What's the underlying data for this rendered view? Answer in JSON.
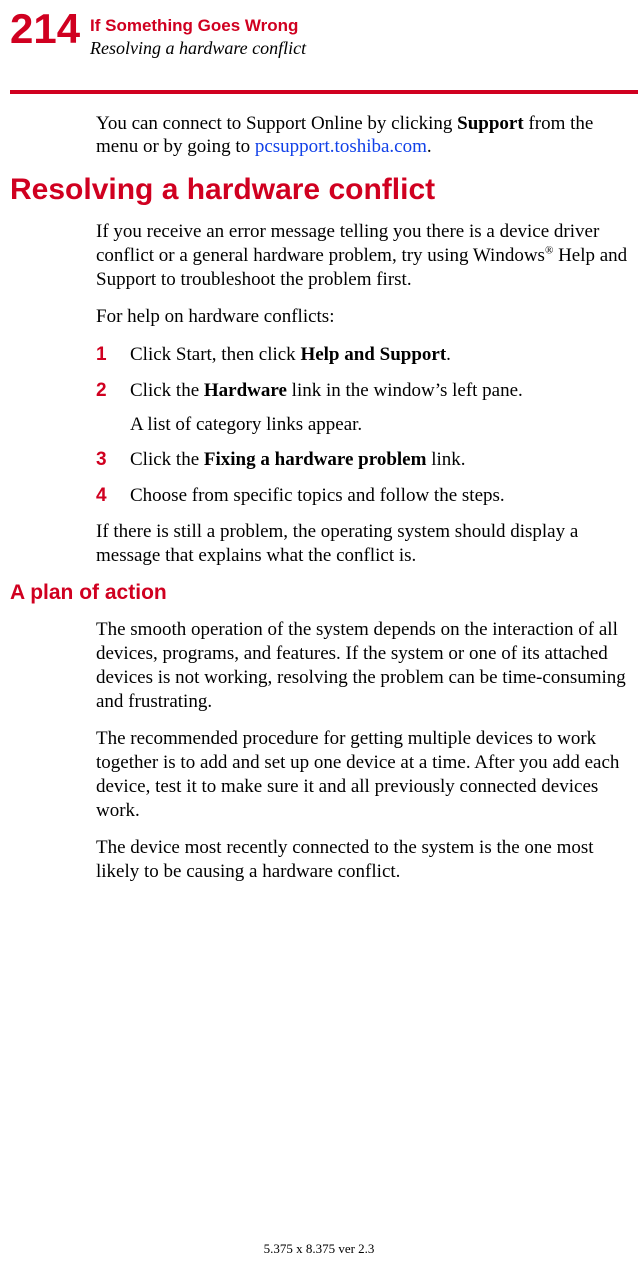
{
  "header": {
    "page_number": "214",
    "chapter": "If Something Goes Wrong",
    "section": "Resolving a hardware conflict"
  },
  "intro": {
    "pre": "You can connect to Support Online by clicking ",
    "bold": "Support",
    "mid": " from the menu or by going to ",
    "link": "pcsupport.toshiba.com",
    "post": "."
  },
  "h1": "Resolving a hardware conflict",
  "para1": {
    "pre": "If you receive an error message telling you there is a device driver conflict or a general hardware problem, try using Windows",
    "sup": "®",
    "post": " Help and Support to troubleshoot the problem first."
  },
  "para2": "For help on hardware conflicts:",
  "steps": [
    {
      "num": "1",
      "pre": "Click Start, then click ",
      "bold": "Help and Support",
      "post": "."
    },
    {
      "num": "2",
      "pre": "Click the ",
      "bold": "Hardware",
      "post": " link in the window’s left pane.",
      "sub": "A list of category links appear."
    },
    {
      "num": "3",
      "pre": "Click the ",
      "bold": "Fixing a hardware problem",
      "post": " link."
    },
    {
      "num": "4",
      "pre": "Choose from specific topics and follow the steps.",
      "bold": "",
      "post": ""
    }
  ],
  "para3": "If there is still a problem, the operating system should display a message that explains what the conflict is.",
  "h2": "A plan of action",
  "para4": "The smooth operation of the system depends on the interaction of all devices, programs, and features. If the system or one of its attached devices is not working, resolving the problem can be time-consuming and frustrating.",
  "para5": "The recommended procedure for getting multiple devices to work together is to add and set up one device at a time. After you add each device, test it to make sure it and all previously connected devices work.",
  "para6": "The device most recently connected to the system is the one most likely to be causing a hardware conflict.",
  "footer": "5.375 x 8.375 ver 2.3"
}
